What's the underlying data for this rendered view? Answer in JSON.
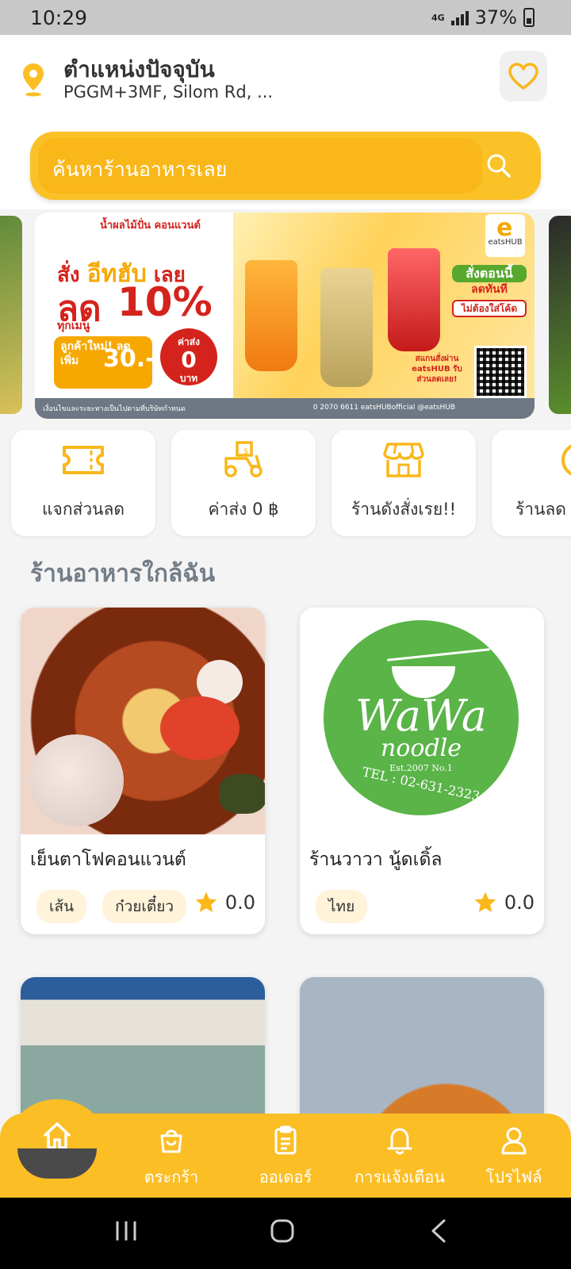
{
  "status": {
    "time": "10:29",
    "network": "4G",
    "battery": "37%"
  },
  "header": {
    "location_title": "ตำแหน่งปัจจุบัน",
    "location_address": "PGGM+3MF, Silom Rd, ..."
  },
  "search": {
    "placeholder": "ค้นหาร้านอาหารเลย"
  },
  "banner": {
    "brand": "น้ำผลไม้ปั่น คอนแวนต์",
    "order_prefix": "สั่ง",
    "order_app": "อีทฮับ",
    "order_suffix": "เลย",
    "discount_word": "ลด",
    "discount_pct": "10%",
    "every_menu": "ทุกเมนู",
    "new_customer": "ลูกค้าใหม่! ลดเพิ่ม",
    "new_customer_amount": "30.-",
    "ship_label": "ค่าส่ง",
    "ship_value": "0",
    "ship_unit": "บาท",
    "logo": "eatsHUB",
    "promo_top": "สั่งตอนนี้",
    "promo_mid": "ลดทันที",
    "promo_bottom": "ไม่ต้องใส่โค้ด",
    "scan": "สแกนสั่งผ่าน eatsHUB รับส่วนลดเลย!",
    "footer_note": "เงื่อนไขและระยะทางเป็นไปตามที่บริษัทกำหนด",
    "footer_contact": "0 2070 6611   eatsHUBofficial   @eatsHUB"
  },
  "categories": [
    {
      "label": "แจกส่วนลด",
      "icon": "ticket-icon"
    },
    {
      "label": "ค่าส่ง 0 ฿",
      "icon": "delivery-scooter-icon"
    },
    {
      "label": "ร้านดังสั่งเรย!!",
      "icon": "storefront-icon"
    },
    {
      "label": "ร้านลด",
      "icon": "discount-badge-icon"
    }
  ],
  "section_title": "ร้านอาหารใกล้ฉัน",
  "restaurants": [
    {
      "name": "เย็นตาโฟคอนแวนต์",
      "tags": [
        "เส้น",
        "ก๋วยเตี๋ยว"
      ],
      "rating": "0.0"
    },
    {
      "name": "ร้านวาวา นู้ดเดิ้ล",
      "tags": [
        "ไทย"
      ],
      "rating": "0.0",
      "logo": {
        "word": "WaWa",
        "sub": "noodle",
        "est": "Est.2007 No.1",
        "tel": "TEL : 02-631-2323"
      }
    },
    {
      "name": "",
      "tags": [],
      "rating": ""
    },
    {
      "name": "",
      "tags": [],
      "rating": ""
    }
  ],
  "bottom_nav": {
    "home": "หน้าหลัก",
    "cart": "ตระกร้า",
    "orders": "ออเดอร์",
    "notifications": "การแจ้งเตือน",
    "profile": "โปรไฟล์"
  },
  "colors": {
    "accent": "#FBBE25",
    "accent_dark": "#F9B71A",
    "title_gray": "#737D87"
  }
}
